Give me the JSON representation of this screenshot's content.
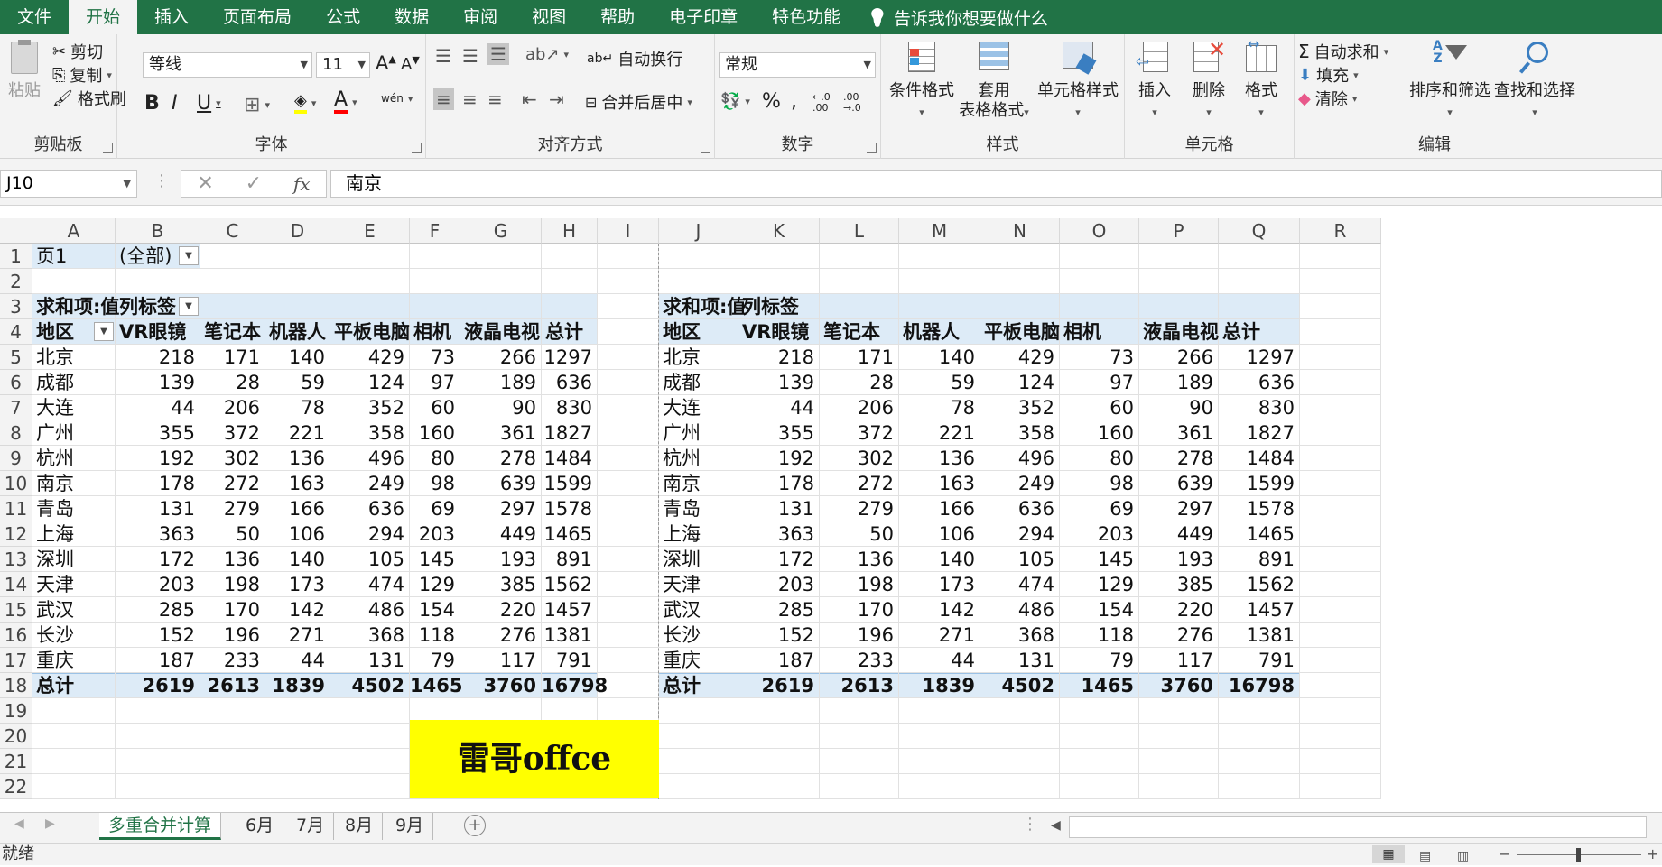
{
  "menu": {
    "tabs": [
      "文件",
      "开始",
      "插入",
      "页面布局",
      "公式",
      "数据",
      "审阅",
      "视图",
      "帮助",
      "电子印章",
      "特色功能"
    ],
    "active": "开始",
    "tell_me": "告诉我你想要做什么"
  },
  "ribbon": {
    "clipboard": {
      "label": "剪贴板",
      "paste": "粘贴",
      "cut": "剪切",
      "copy": "复制",
      "format_painter": "格式刷"
    },
    "font": {
      "label": "字体",
      "font_name": "等线",
      "font_size": "11",
      "bold": "B",
      "italic": "I",
      "underline": "U",
      "wen": "wén"
    },
    "alignment": {
      "label": "对齐方式",
      "wrap": "自动换行",
      "merge": "合并后居中"
    },
    "number": {
      "label": "数字",
      "format": "常规"
    },
    "styles": {
      "label": "样式",
      "conditional": "条件格式",
      "table_format_1": "套用",
      "table_format_2": "表格格式",
      "cell_styles": "单元格样式"
    },
    "cells": {
      "label": "单元格",
      "insert": "插入",
      "delete": "删除",
      "format": "格式"
    },
    "editing": {
      "label": "编辑",
      "autosum": "自动求和",
      "fill": "填充",
      "clear": "清除",
      "sort_filter": "排序和筛选",
      "find_select": "查找和选择"
    }
  },
  "formula_bar": {
    "name_box": "J10",
    "content": "南京",
    "fx": "fx"
  },
  "columns": [
    "A",
    "B",
    "C",
    "D",
    "E",
    "F",
    "G",
    "H",
    "I",
    "J",
    "K",
    "L",
    "M",
    "N",
    "O",
    "P",
    "Q",
    "R"
  ],
  "rows": [
    "1",
    "2",
    "3",
    "4",
    "5",
    "6",
    "7",
    "8",
    "9",
    "10",
    "11",
    "12",
    "13",
    "14",
    "15",
    "16",
    "17",
    "18",
    "19",
    "20",
    "21",
    "22"
  ],
  "pivot": {
    "page_label": "页1",
    "page_value": "(全部)",
    "values_label": "求和项:值",
    "col_label": "列标签",
    "row_label": "地区",
    "headers": [
      "VR眼镜",
      "笔记本",
      "机器人",
      "平板电脑",
      "相机",
      "液晶电视",
      "总计"
    ],
    "data": [
      [
        "北京",
        "218",
        "171",
        "140",
        "429",
        "73",
        "266",
        "1297"
      ],
      [
        "成都",
        "139",
        "28",
        "59",
        "124",
        "97",
        "189",
        "636"
      ],
      [
        "大连",
        "44",
        "206",
        "78",
        "352",
        "60",
        "90",
        "830"
      ],
      [
        "广州",
        "355",
        "372",
        "221",
        "358",
        "160",
        "361",
        "1827"
      ],
      [
        "杭州",
        "192",
        "302",
        "136",
        "496",
        "80",
        "278",
        "1484"
      ],
      [
        "南京",
        "178",
        "272",
        "163",
        "249",
        "98",
        "639",
        "1599"
      ],
      [
        "青岛",
        "131",
        "279",
        "166",
        "636",
        "69",
        "297",
        "1578"
      ],
      [
        "上海",
        "363",
        "50",
        "106",
        "294",
        "203",
        "449",
        "1465"
      ],
      [
        "深圳",
        "172",
        "136",
        "140",
        "105",
        "145",
        "193",
        "891"
      ],
      [
        "天津",
        "203",
        "198",
        "173",
        "474",
        "129",
        "385",
        "1562"
      ],
      [
        "武汉",
        "285",
        "170",
        "142",
        "486",
        "154",
        "220",
        "1457"
      ],
      [
        "长沙",
        "152",
        "196",
        "271",
        "368",
        "118",
        "276",
        "1381"
      ],
      [
        "重庆",
        "187",
        "233",
        "44",
        "131",
        "79",
        "117",
        "791"
      ]
    ],
    "total": [
      "总计",
      "2619",
      "2613",
      "1839",
      "4502",
      "1465",
      "3760",
      "16798"
    ]
  },
  "banner": "雷哥offce",
  "sheets": [
    "多重合并计算",
    "6月",
    "7月",
    "8月",
    "9月"
  ],
  "active_sheet": "多重合并计算",
  "status": "就绪"
}
